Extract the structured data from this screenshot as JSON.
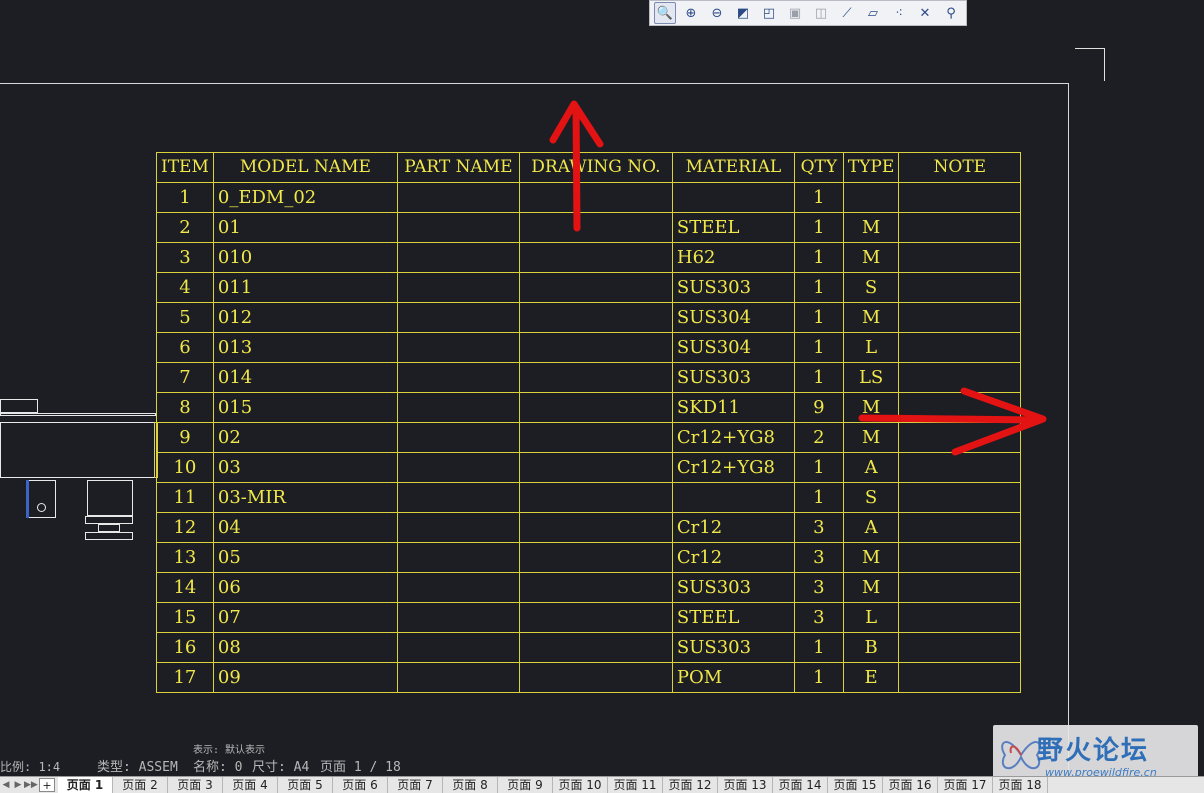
{
  "toolbar": {
    "buttons": [
      {
        "icon": "zoom-fit-icon",
        "glyph": "🔍"
      },
      {
        "icon": "zoom-in-icon",
        "glyph": "⊕"
      },
      {
        "icon": "zoom-out-icon",
        "glyph": "⊖"
      },
      {
        "icon": "shade-icon",
        "glyph": "◩"
      },
      {
        "icon": "cube-icon",
        "glyph": "◰"
      },
      {
        "icon": "saved-views-icon",
        "glyph": "▣"
      },
      {
        "icon": "display-style-icon",
        "glyph": "◫"
      },
      {
        "icon": "datum-axis-icon",
        "glyph": "⟋"
      },
      {
        "icon": "datum-plane-icon",
        "glyph": "▱"
      },
      {
        "icon": "datum-point-icon",
        "glyph": "⁖"
      },
      {
        "icon": "csys-icon",
        "glyph": "✕"
      },
      {
        "icon": "annotation-icon",
        "glyph": "⚲"
      }
    ]
  },
  "bom": {
    "headers": [
      "ITEM",
      "MODEL NAME",
      "PART NAME",
      "DRAWING NO.",
      "MATERIAL",
      "QTY",
      "TYPE",
      "NOTE"
    ],
    "rows": [
      [
        "1",
        "0_EDM_02",
        "",
        "",
        "",
        "1",
        "",
        ""
      ],
      [
        "2",
        "01",
        "",
        "",
        "STEEL",
        "1",
        "M",
        ""
      ],
      [
        "3",
        "010",
        "",
        "",
        "H62",
        "1",
        "M",
        ""
      ],
      [
        "4",
        "011",
        "",
        "",
        "SUS303",
        "1",
        "S",
        ""
      ],
      [
        "5",
        "012",
        "",
        "",
        "SUS304",
        "1",
        "M",
        ""
      ],
      [
        "6",
        "013",
        "",
        "",
        "SUS304",
        "1",
        "L",
        ""
      ],
      [
        "7",
        "014",
        "",
        "",
        "SUS303",
        "1",
        "LS",
        ""
      ],
      [
        "8",
        "015",
        "",
        "",
        "SKD11",
        "9",
        "M",
        ""
      ],
      [
        "9",
        "02",
        "",
        "",
        "Cr12+YG8",
        "2",
        "M",
        ""
      ],
      [
        "10",
        "03",
        "",
        "",
        "Cr12+YG8",
        "1",
        "A",
        ""
      ],
      [
        "11",
        "03-MIR",
        "",
        "",
        "",
        "1",
        "S",
        ""
      ],
      [
        "12",
        "04",
        "",
        "",
        "Cr12",
        "3",
        "A",
        ""
      ],
      [
        "13",
        "05",
        "",
        "",
        "Cr12",
        "3",
        "M",
        ""
      ],
      [
        "14",
        "06",
        "",
        "",
        "SUS303",
        "3",
        "M",
        ""
      ],
      [
        "15",
        "07",
        "",
        "",
        "STEEL",
        "3",
        "L",
        ""
      ],
      [
        "16",
        "08",
        "",
        "",
        "SUS303",
        "1",
        "B",
        ""
      ],
      [
        "17",
        "09",
        "",
        "",
        "POM",
        "1",
        "E",
        ""
      ]
    ]
  },
  "status": {
    "scale": "比例: 1:4",
    "type": "类型: ASSEM",
    "display": "表示: 默认表示",
    "name": "名称: 0",
    "size": "尺寸: A4",
    "page": "页面 1 / 18"
  },
  "watermark": {
    "title": "野火论坛",
    "url": "www.proewildfire.cn"
  },
  "tabs": {
    "add": "+",
    "pages": [
      "页面 1",
      "页面 2",
      "页面 3",
      "页面 4",
      "页面 5",
      "页面 6",
      "页面 7",
      "页面 8",
      "页面 9",
      "页面 10",
      "页面 11",
      "页面 12",
      "页面 13",
      "页面 14",
      "页面 15",
      "页面 16",
      "页面 17",
      "页面 18"
    ],
    "active_index": 0
  },
  "colors": {
    "background": "#1d1d24",
    "table_text": "#f0e84a",
    "annotation": "#e31313"
  }
}
